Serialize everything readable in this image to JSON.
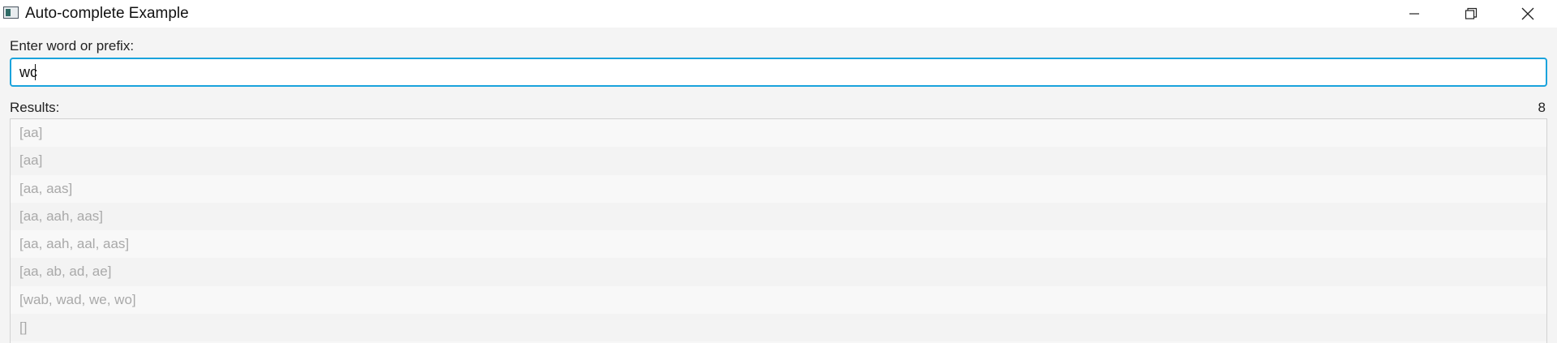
{
  "window": {
    "title": "Auto-complete Example",
    "icon": "java-app-icon",
    "controls": [
      "minimize-icon",
      "restore-icon",
      "close-icon"
    ]
  },
  "form": {
    "prompt_label": "Enter word or prefix:",
    "input_value": "wc"
  },
  "results": {
    "label": "Results:",
    "count": "8",
    "items": [
      "[aa]",
      "[aa]",
      "[aa, aas]",
      "[aa, aah, aas]",
      "[aa, aah, aal, aas]",
      "[aa, ab, ad, ae]",
      "[wab, wad, we, wo]",
      "[]"
    ]
  },
  "colors": {
    "focus_border": "#1aa3dc",
    "disabled_text": "#a9a9a9"
  }
}
